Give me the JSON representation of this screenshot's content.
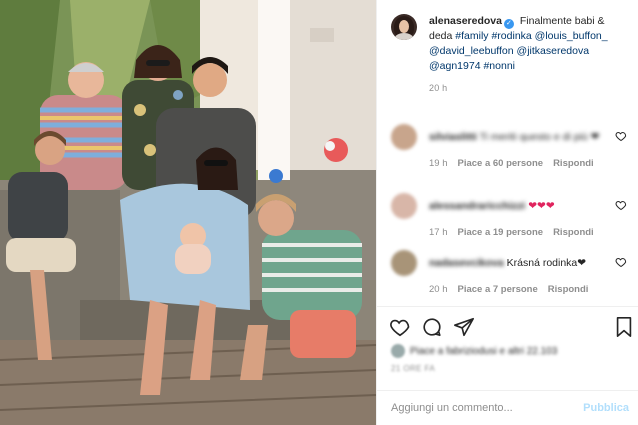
{
  "post": {
    "username": "alenaseredova",
    "caption_text": "Finalmente babi & deda",
    "caption_links": [
      "#family",
      "#rodinka",
      "@louis_buffon_",
      "@david_leebuffon",
      "@jitkaseredova",
      "@agn1974",
      "#nonni"
    ],
    "time": "20 h"
  },
  "comments": [
    {
      "username": "silviaslitti",
      "text": "Ti meriti questo e di più ❤",
      "time": "19 h",
      "likes": "Piace a 60 persone",
      "reply": "Rispondi",
      "avatar_color": "#c8a58c"
    },
    {
      "username": "alessandraricchizzi",
      "text": "❤❤❤",
      "time": "17 h",
      "likes": "Piace a 19 persone",
      "reply": "Rispondi",
      "avatar_color": "#d8b6a8"
    },
    {
      "username": "nadasevcikova",
      "text": "Krásná rodinka❤",
      "time": "20 h",
      "likes": "Piace a 7 persone",
      "reply": "Rispondi",
      "avatar_color": "#a89478"
    }
  ],
  "footer": {
    "likes_text": "Piace a fabriziodusi e altri 22.103",
    "date": "21 ORE FA",
    "comment_placeholder": "Aggiungi un commento...",
    "publish_label": "Pubblica"
  },
  "icons": {
    "like": "heart-icon",
    "comment": "comment-icon",
    "share": "share-icon",
    "save": "bookmark-icon"
  },
  "colors": {
    "link": "#00376b",
    "verified": "#3897f0",
    "publish_disabled": "#b2dffc",
    "meta": "#8e8e8e"
  }
}
